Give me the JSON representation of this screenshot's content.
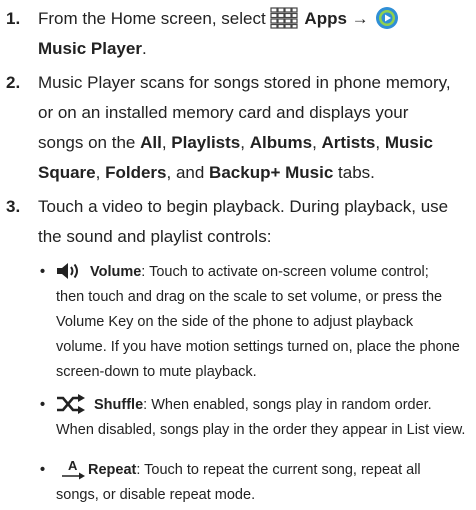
{
  "steps": [
    {
      "num": "1.",
      "pre": "From the Home screen, select ",
      "apps_label": "Apps",
      "arrow": "→",
      "music_label": "Music Player",
      "end": ".",
      "icons": {
        "apps": "apps-grid-icon",
        "music": "music-player-icon"
      }
    },
    {
      "num": "2.",
      "line1": "Music Player scans for songs stored in phone memory,",
      "line2": "or on an installed memory card and displays your",
      "line3_pre": "songs on the ",
      "tab_all": "All",
      "sep1": ", ",
      "tab_playlists": "Playlists",
      "sep2": ", ",
      "tab_albums": "Albums",
      "sep3": ", ",
      "tab_artists": "Artists",
      "sep4": ", ",
      "tab_music": "Music",
      "tab_square": "Square",
      "sep5": ", ",
      "tab_folders": "Folders",
      "sep6": ", and ",
      "tab_backup": "Backup+ Music",
      "line4_end": " tabs."
    },
    {
      "num": "3.",
      "line1": "Touch a video to begin playback. During playback, use",
      "line2": "the sound and playlist controls:"
    }
  ],
  "bullets": [
    {
      "marker": "•",
      "icon": "volume-icon",
      "label": "Volume",
      "lines": [
        ": Touch to activate on-screen volume control;",
        "then touch and drag on the scale to set volume, or press the",
        "Volume Key on the side of the phone to adjust playback",
        "volume. If you have motion settings turned on, place the phone",
        "screen-down to mute playback."
      ]
    },
    {
      "marker": "•",
      "icon": "shuffle-icon",
      "label": "Shuffle",
      "lines": [
        ": When enabled, songs play in random order.",
        "When disabled, songs play in the order they appear in List view."
      ]
    },
    {
      "marker": "•",
      "icon": "repeat-icon",
      "icon_letter": "A",
      "label": "Repeat",
      "lines": [
        ": Touch to repeat the current song, repeat all",
        "songs, or disable repeat mode."
      ]
    }
  ],
  "colors": {
    "text": "#222222",
    "music_icon_outer": "#2f8fd6",
    "music_icon_inner": "#8fd14f"
  }
}
